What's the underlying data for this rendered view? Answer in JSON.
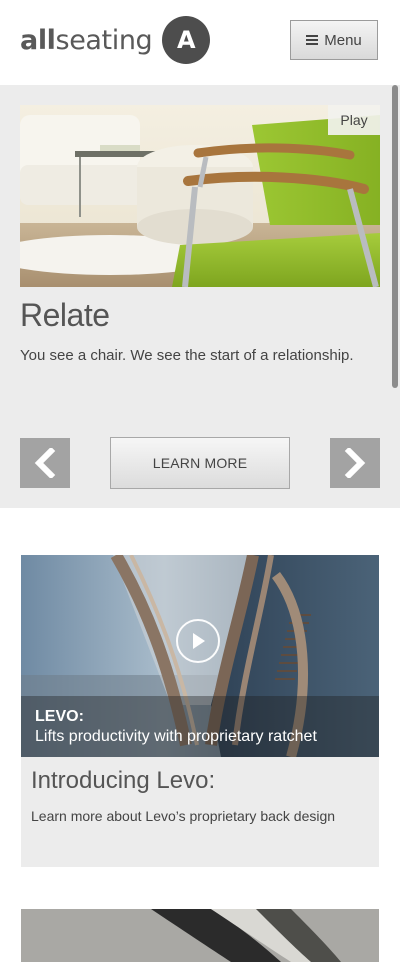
{
  "header": {
    "logo_text_bold": "all",
    "logo_text_rest": "seating",
    "logo_mark": "A",
    "menu_label": "Menu",
    "menu_icon": "hamburger-icon"
  },
  "hero": {
    "play_label": "Play",
    "title": "Relate",
    "description": "You see a chair. We see the start of a relationship.",
    "learn_more_label": "LEARN MORE",
    "prev_icon": "chevron-left-icon",
    "next_icon": "chevron-right-icon",
    "image_subject": "green-chair-photo"
  },
  "feature": {
    "video_title": "LEVO:",
    "video_subtitle": "Lifts productivity with proprietary ratchet",
    "title": "Introducing Levo:",
    "description": "Learn more about Levo’s proprietary back design",
    "play_icon": "play-circle-icon"
  },
  "colors": {
    "panel_bg": "#ececec",
    "arrow_bg": "#a3a3a3",
    "chair_green": "#8fbf2a",
    "logo_dark": "#4d4d4d"
  }
}
